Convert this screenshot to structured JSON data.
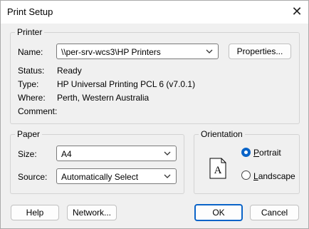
{
  "window": {
    "title": "Print Setup"
  },
  "printer": {
    "group_label": "Printer",
    "name_label": "Name:",
    "name_value": "\\\\per-srv-wcs3\\HP Printers",
    "properties_label": "Properties...",
    "status_label": "Status:",
    "status_value": "Ready",
    "type_label": "Type:",
    "type_value": "HP Universal Printing PCL 6 (v7.0.1)",
    "where_label": "Where:",
    "where_value": "Perth, Western Australia",
    "comment_label": "Comment:",
    "comment_value": ""
  },
  "paper": {
    "group_label": "Paper",
    "size_label": "Size:",
    "size_value": "A4",
    "source_label": "Source:",
    "source_value": "Automatically Select"
  },
  "orientation": {
    "group_label": "Orientation",
    "portrait_label": "Portrait",
    "landscape_label": "Landscape",
    "selected": "portrait",
    "preview_glyph": "A"
  },
  "buttons": {
    "help": "Help",
    "network": "Network...",
    "ok": "OK",
    "cancel": "Cancel"
  },
  "colors": {
    "accent": "#0a64c8",
    "background": "#f0f0f0"
  }
}
